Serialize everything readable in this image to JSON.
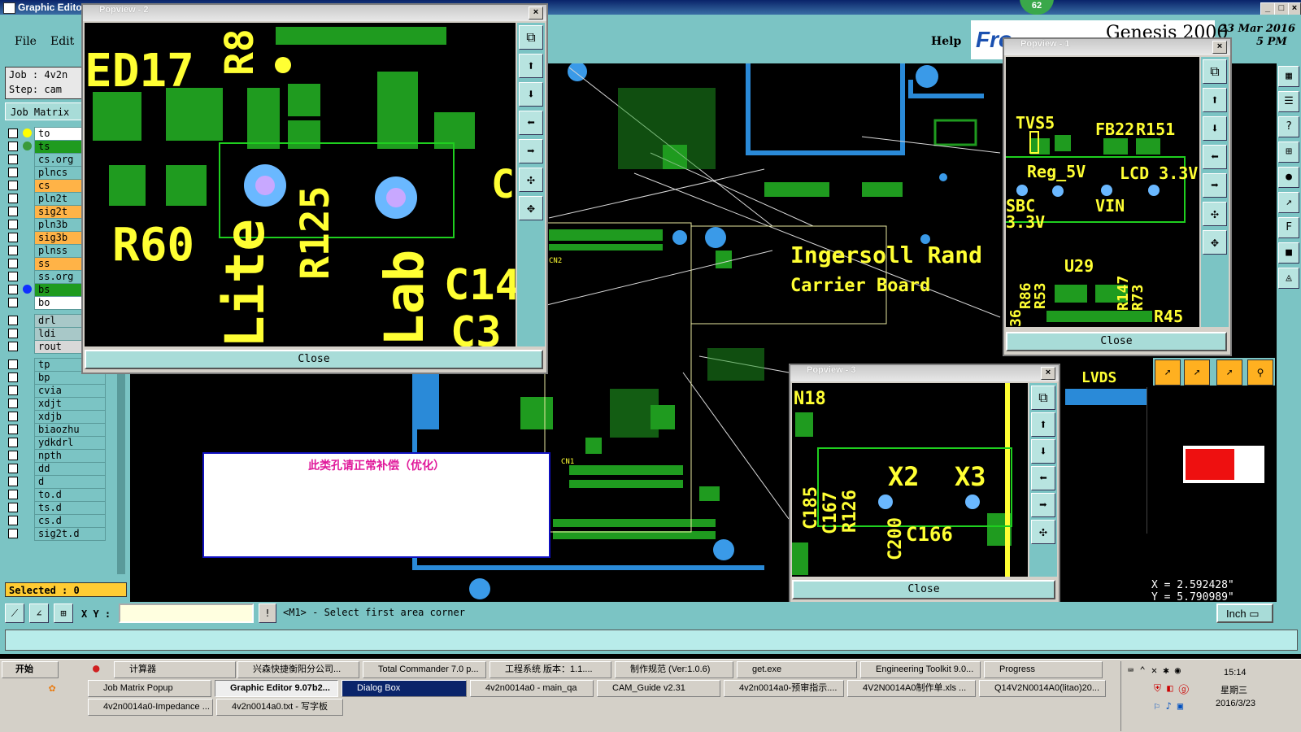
{
  "main_window": {
    "title": "Graphic Edito",
    "menu": {
      "file": "File",
      "edit": "Edit",
      "help": "Help"
    },
    "brand": "Genesis 2000",
    "brand_logo": "Fro",
    "date": "23 Mar 2016",
    "time_fragment": "5 PM",
    "badge_count": "62"
  },
  "sidebar": {
    "job": "Job : 4v2n",
    "step": "Step: cam",
    "job_matrix": "Job Matrix",
    "selected": "Selected : 0",
    "layers": [
      {
        "name": "to",
        "color": "#ffffff",
        "dot": "#ffff00"
      },
      {
        "name": "ts",
        "color": "#1f9b1f",
        "dot": "#3a9a3a"
      },
      {
        "name": "cs.org",
        "color": "#7bc4c4"
      },
      {
        "name": "plncs",
        "color": "#7bc4c4"
      },
      {
        "name": "cs",
        "color": "#ffb347"
      },
      {
        "name": "pln2t",
        "color": "#7bc4c4"
      },
      {
        "name": "sig2t",
        "color": "#ffb347"
      },
      {
        "name": "pln3b",
        "color": "#7bc4c4"
      },
      {
        "name": "sig3b",
        "color": "#ffb347"
      },
      {
        "name": "plnss",
        "color": "#7bc4c4"
      },
      {
        "name": "ss",
        "color": "#ffb347"
      },
      {
        "name": "ss.org",
        "color": "#7bc4c4"
      },
      {
        "name": "bs",
        "color": "#1f9b1f",
        "dot": "#1030ff"
      },
      {
        "name": "bo",
        "color": "#ffffff"
      },
      {
        "name": "drl",
        "color": "#a8c8c8"
      },
      {
        "name": "ldi",
        "color": "#a8c8c8"
      },
      {
        "name": "rout",
        "color": "#d8d8d8"
      },
      {
        "name": "tp",
        "color": "#7bc4c4"
      },
      {
        "name": "bp",
        "color": "#7bc4c4"
      },
      {
        "name": "cvia",
        "color": "#7bc4c4"
      },
      {
        "name": "xdjt",
        "color": "#7bc4c4"
      },
      {
        "name": "xdjb",
        "color": "#7bc4c4"
      },
      {
        "name": "biaozhu",
        "color": "#7bc4c4"
      },
      {
        "name": "ydkdrl",
        "color": "#7bc4c4"
      },
      {
        "name": "npth",
        "color": "#7bc4c4"
      },
      {
        "name": "dd",
        "color": "#7bc4c4"
      },
      {
        "name": "d",
        "color": "#7bc4c4"
      },
      {
        "name": "to.d",
        "color": "#7bc4c4"
      },
      {
        "name": "ts.d",
        "color": "#7bc4c4"
      },
      {
        "name": "cs.d",
        "color": "#7bc4c4"
      },
      {
        "name": "sig2t.d",
        "color": "#7bc4c4"
      }
    ]
  },
  "board": {
    "label1": "Ingersoll Rand",
    "label2": "Carrier Board",
    "lvds": "LVDS",
    "cn2": "CN2",
    "cn1": "CN1"
  },
  "dialog": {
    "message": "此类孔请正常补偿（优化）"
  },
  "popview2": {
    "title": "Popview - 2",
    "close": "Close",
    "labels": [
      "ED17",
      "R8",
      "R60",
      "Lite",
      "R125",
      "Lab",
      "C14",
      "C3",
      "C"
    ]
  },
  "popview1": {
    "title": "Popview - 1",
    "close": "Close",
    "labels": [
      "TVS5",
      "FB22",
      "R151",
      "Reg_5V",
      "LCD 3.3V",
      "SBC",
      "3.3V",
      "VIN",
      "U29",
      "R86",
      "R53",
      "R147",
      "R73",
      "R45",
      "36"
    ]
  },
  "popview3": {
    "title": "Popview - 3",
    "close": "Close",
    "labels": [
      "N18",
      "X2",
      "X3",
      "C185",
      "C167",
      "R126",
      "C200",
      "C166"
    ]
  },
  "status": {
    "xy_label": "X Y :",
    "prompt": "<M1> - Select first area corner",
    "unit": "Inch",
    "coord_x": "X = 2.592428\"",
    "coord_y": "Y = 5.790989\""
  },
  "taskbar": {
    "start": "开始",
    "row1": [
      "计算器",
      "兴森快捷衡阳分公司...",
      "Total Commander 7.0 p...",
      "工程系统  版本：1.1....",
      "制作规范 (Ver:1.0.6)",
      "get.exe",
      "Engineering Toolkit 9.0...",
      "Progress"
    ],
    "row2": [
      "Job Matrix Popup",
      "Graphic Editor 9.07b2...",
      "Dialog Box",
      "4v2n0014a0 - main_qa",
      "CAM_Guide v2.31",
      "4v2n0014a0-预审指示....",
      "4V2N0014A0制作单.xls ...",
      "Q14V2N0014A0(litao)20..."
    ],
    "row3": [
      "4v2n0014a0-Impedance ...",
      "4v2n0014a0.txt - 写字板"
    ],
    "clock_time": "15:14",
    "clock_day": "星期三",
    "clock_date": "2016/3/23"
  }
}
